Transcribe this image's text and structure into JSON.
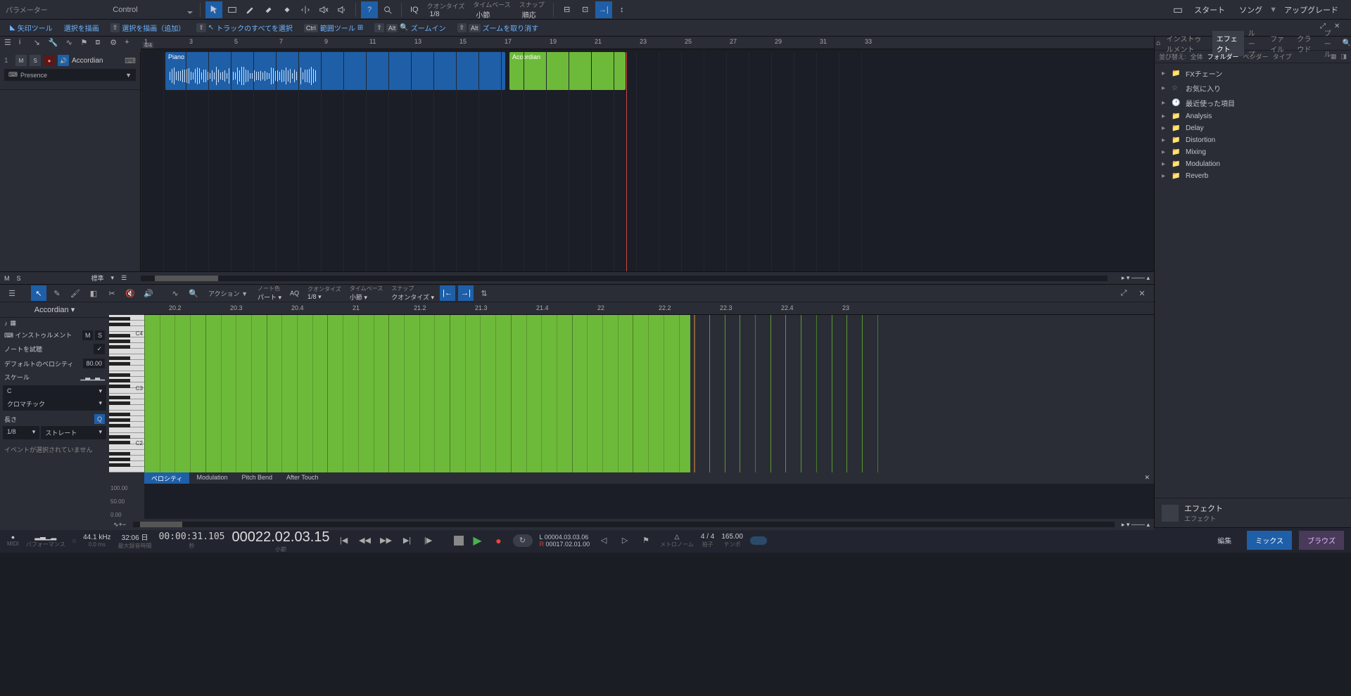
{
  "topbar": {
    "parameter_label": "パラメーター",
    "control": "Control",
    "quantize": {
      "label": "クオンタイズ",
      "value": "1/8"
    },
    "timebase": {
      "label": "タイムベース",
      "value": "小節"
    },
    "snap": {
      "label": "スナップ",
      "value": "順応"
    },
    "iq": "IQ",
    "start": "スタート",
    "song": "ソング",
    "upgrade": "アップグレード"
  },
  "toolbar2": {
    "arrow_tool": "矢印ツール",
    "draw_selection": "選択を描画",
    "draw_selection_add": "選択を描画（追加）",
    "select_all_track": "トラックのすべてを選択",
    "range_tool": "範囲ツール",
    "ctrl": "Ctrl",
    "alt": "Alt",
    "zoom_in": "ズームイン",
    "zoom_undo": "ズームを取り消す"
  },
  "ruler": {
    "markers": [
      "1",
      "3",
      "5",
      "7",
      "9",
      "11",
      "13",
      "15",
      "17",
      "19",
      "21",
      "23",
      "25",
      "27",
      "29",
      "31",
      "33"
    ],
    "timesig": "4/4"
  },
  "track": {
    "num": "1",
    "m": "M",
    "s": "S",
    "name": "Accordian",
    "preset": "Presence"
  },
  "clips": {
    "piano": "Piano",
    "accordian": "Accordian"
  },
  "arr_bottom": {
    "m": "M",
    "s": "S",
    "standard": "標準"
  },
  "midi": {
    "title": "Accordian",
    "action": "アクション",
    "note_color": {
      "label": "ノート色",
      "value": "パート"
    },
    "aq": "AQ",
    "quantize": {
      "label": "クオンタイズ",
      "value": "1/8"
    },
    "timebase": {
      "label": "タイムベース",
      "value": "小節"
    },
    "snap": {
      "label": "スナップ",
      "value": "クオンタイズ"
    },
    "ruler": [
      "20.2",
      "20.3",
      "20.4",
      "21",
      "21.2",
      "21.3",
      "21.4",
      "22",
      "22.2",
      "22.3",
      "22.4",
      "23"
    ],
    "left": {
      "instrument": "インストゥルメント",
      "m": "M",
      "s": "S",
      "preview_note": "ノートを試聴",
      "default_velocity_label": "デフォルトのベロシティ",
      "default_velocity": "80.00",
      "scale": "スケール",
      "c": "C",
      "chromatic": "クロマチック",
      "length": "長さ",
      "length_val": "1/8",
      "straight": "ストレート",
      "no_selection": "イベントが選択されていません"
    },
    "piano_labels": [
      "C4",
      "C3",
      "C2"
    ],
    "vtabs": {
      "velocity": "ベロシティ",
      "modulation": "Modulation",
      "pitchbend": "Pitch Bend",
      "aftertouch": "After Touch"
    },
    "vscale": [
      "100.00",
      "50.00",
      "0.00"
    ]
  },
  "browser": {
    "tabs": {
      "instruments": "インストゥルメント",
      "effects": "エフェクト",
      "loops": "ループ",
      "files": "ファイル",
      "cloud": "クラウド",
      "pool": "プール"
    },
    "sort": {
      "label": "並び替え:",
      "all": "全体",
      "folder": "フォルダー",
      "vendor": "ベンダー",
      "type": "タイプ"
    },
    "tree": [
      {
        "name": "FXチェーン",
        "icon": "folder"
      },
      {
        "name": "お気に入り",
        "icon": "star"
      },
      {
        "name": "最近使った項目",
        "icon": "clock"
      },
      {
        "name": "Analysis",
        "icon": "folder"
      },
      {
        "name": "Delay",
        "icon": "folder"
      },
      {
        "name": "Distortion",
        "icon": "folder"
      },
      {
        "name": "Mixing",
        "icon": "folder"
      },
      {
        "name": "Modulation",
        "icon": "folder"
      },
      {
        "name": "Reverb",
        "icon": "folder"
      }
    ],
    "footer": {
      "title": "エフェクト",
      "sub": "エフェクト"
    }
  },
  "transport": {
    "midi": "MIDI",
    "performance": "パフォーマンス",
    "sample_rate": "44.1 kHz",
    "cpu": "0.0 ms",
    "duration": "32:06 日",
    "max_rec": "最大録音時間",
    "time": "00:00:31.105",
    "time_label": "秒",
    "position": "00022.02.03.15",
    "position_label": "小節",
    "loop_l": "00004.03.03.06",
    "loop_r": "00017.02.01.00",
    "l": "L",
    "r": "R",
    "metronome": "メトロノーム",
    "timesig": "4 / 4",
    "timesig_label": "拍子",
    "tempo": "165.00",
    "tempo_label": "テンポ",
    "edit": "編集",
    "mix": "ミックス",
    "browse": "ブラウズ"
  }
}
